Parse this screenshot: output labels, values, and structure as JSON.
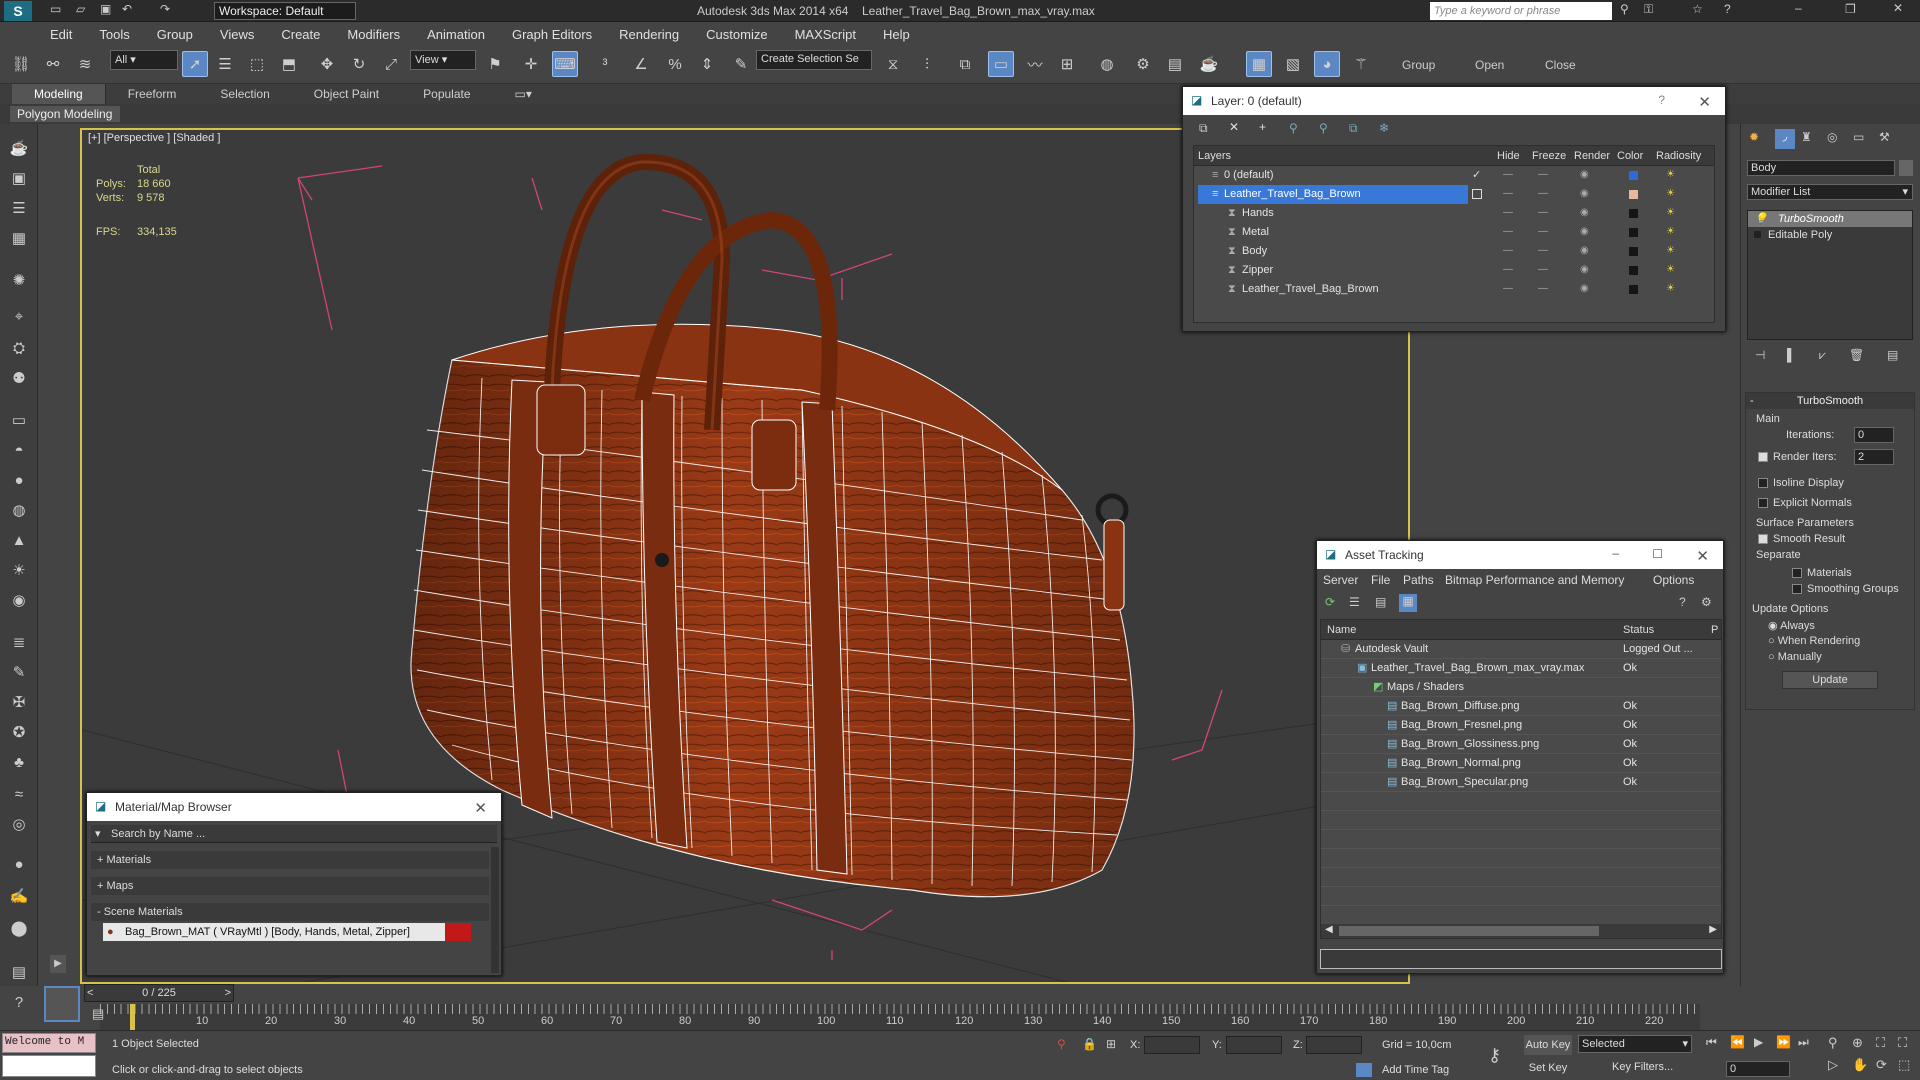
{
  "titlebar": {
    "workspace": "Workspace: Default",
    "app_title": "Autodesk 3ds Max  2014 x64",
    "file_title": "Leather_Travel_Bag_Brown_max_vray.max",
    "search_placeholder": "Type a keyword or phrase"
  },
  "menu": [
    "Edit",
    "Tools",
    "Group",
    "Views",
    "Create",
    "Modifiers",
    "Animation",
    "Graph Editors",
    "Rendering",
    "Customize",
    "MAXScript",
    "Help"
  ],
  "toolbar": {
    "filter_value": "All",
    "ref_coord_value": "View",
    "selection_set_value": "Create Selection Se",
    "group_label": "Group",
    "open_label": "Open",
    "close_label": "Close"
  },
  "ribbon": {
    "tabs": [
      "Modeling",
      "Freeform",
      "Selection",
      "Object Paint",
      "Populate"
    ],
    "panel_label": "Polygon Modeling"
  },
  "viewport": {
    "label": "[+] [Perspective ] [Shaded ]",
    "stats_header": "Total",
    "polys_label": "Polys:",
    "polys_value": "18 660",
    "verts_label": "Verts:",
    "verts_value": "9 578",
    "fps_label": "FPS:",
    "fps_value": "334,135"
  },
  "layer_window": {
    "title": "Layer: 0 (default)",
    "help": "?",
    "columns": [
      "Layers",
      "Hide",
      "Freeze",
      "Render",
      "Color",
      "Radiosity"
    ],
    "rows": [
      {
        "name": "0 (default)",
        "color": "#2b6cd8"
      },
      {
        "name": "Leather_Travel_Bag_Brown",
        "color": "#e8b89a"
      },
      {
        "name": "Hands",
        "color": "#151515"
      },
      {
        "name": "Metal",
        "color": "#151515"
      },
      {
        "name": "Body",
        "color": "#151515"
      },
      {
        "name": "Zipper",
        "color": "#151515"
      },
      {
        "name": "Leather_Travel_Bag_Brown",
        "color": "#151515"
      }
    ]
  },
  "asset_window": {
    "title": "Asset Tracking",
    "menu": [
      "Server",
      "File",
      "Paths",
      "Bitmap Performance and Memory",
      "Options"
    ],
    "columns": [
      "Name",
      "Status",
      "P"
    ],
    "rows": [
      {
        "name": "Autodesk Vault",
        "status": "Logged Out ..."
      },
      {
        "name": "Leather_Travel_Bag_Brown_max_vray.max",
        "status": "Ok"
      },
      {
        "name": "Maps / Shaders",
        "status": ""
      },
      {
        "name": "Bag_Brown_Diffuse.png",
        "status": "Ok"
      },
      {
        "name": "Bag_Brown_Fresnel.png",
        "status": "Ok"
      },
      {
        "name": "Bag_Brown_Glossiness.png",
        "status": "Ok"
      },
      {
        "name": "Bag_Brown_Normal.png",
        "status": "Ok"
      },
      {
        "name": "Bag_Brown_Specular.png",
        "status": "Ok"
      }
    ]
  },
  "material_browser": {
    "title": "Material/Map Browser",
    "search_placeholder": "Search by Name ...",
    "sections": [
      "+ Materials",
      "+ Maps",
      "- Scene Materials"
    ],
    "item": "Bag_Brown_MAT  ( VRayMtl )  [Body, Hands, Metal, Zipper]"
  },
  "command_panel": {
    "object_name": "Body",
    "modifier_list": "Modifier List",
    "stack": [
      "TurboSmooth",
      "Editable Poly"
    ],
    "rollout_title": "TurboSmooth",
    "main_label": "Main",
    "iterations_label": "Iterations:",
    "iterations_value": "0",
    "render_iters_label": "Render Iters:",
    "render_iters_value": "2",
    "isoline": "Isoline Display",
    "explicit_normals": "Explicit Normals",
    "surface_params": "Surface Parameters",
    "smooth_result": "Smooth Result",
    "separate": "Separate",
    "materials": "Materials",
    "smoothing_groups": "Smoothing Groups",
    "update_options": "Update Options",
    "always": "Always",
    "when_rendering": "When Rendering",
    "manually": "Manually",
    "update_button": "Update"
  },
  "timeline": {
    "frame_counter": "0 / 225",
    "ticks": [
      "10",
      "20",
      "30",
      "40",
      "50",
      "60",
      "70",
      "80",
      "90",
      "100",
      "110",
      "120",
      "130",
      "140",
      "150",
      "160",
      "170",
      "180",
      "190",
      "200",
      "210",
      "220"
    ]
  },
  "statusbar": {
    "maxscript": "Welcome to M",
    "selected": "1 Object Selected",
    "prompt": "Click or click-and-drag to select objects",
    "x_label": "X:",
    "y_label": "Y:",
    "z_label": "Z:",
    "grid": "Grid = 10,0cm",
    "add_time_tag": "Add Time Tag",
    "auto_key": "Auto Key",
    "set_key": "Set Key",
    "selected_combo": "Selected",
    "key_filters": "Key Filters...",
    "frame_value": "0"
  }
}
